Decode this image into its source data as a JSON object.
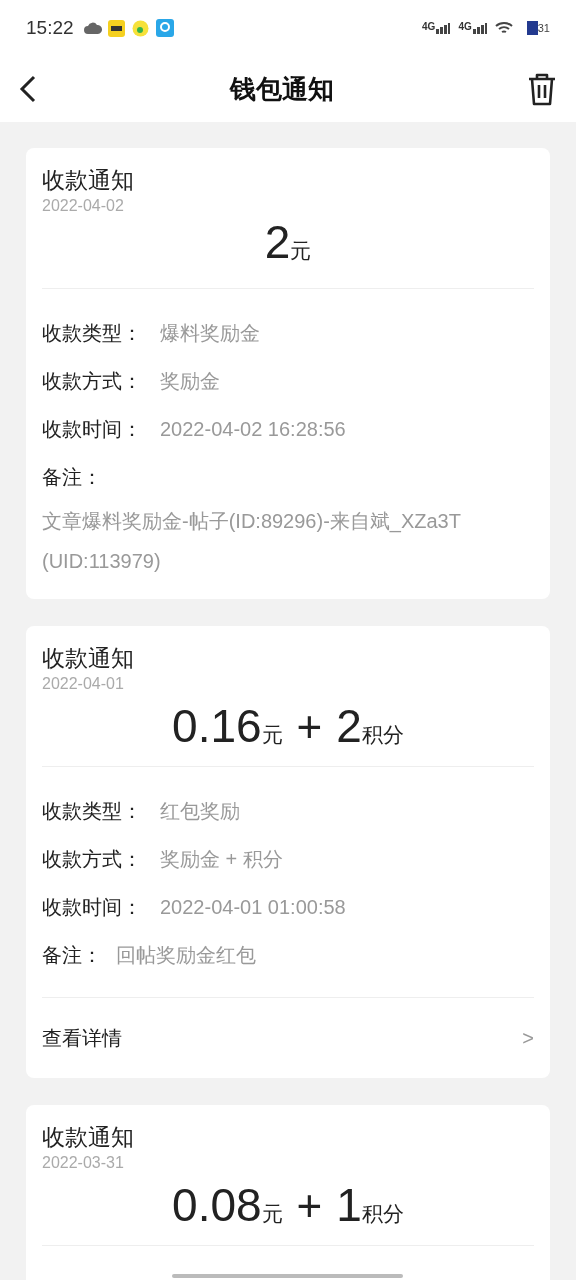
{
  "status_bar": {
    "time": "15:22",
    "network_1": "4G",
    "network_2": "4G",
    "battery": "31"
  },
  "header": {
    "title": "钱包通知"
  },
  "cards": [
    {
      "title": "收款通知",
      "date": "2022-04-02",
      "amount": [
        {
          "kind": "number",
          "text": "2"
        },
        {
          "kind": "unit",
          "text": "元"
        }
      ],
      "fields": [
        {
          "label": "收款类型：",
          "value": "爆料奖励金"
        },
        {
          "label": "收款方式：",
          "value": "奖励金"
        },
        {
          "label": "收款时间：",
          "value": "2022-04-02 16:28:56"
        }
      ],
      "note": {
        "kind": "block",
        "label": "备注：",
        "value": "文章爆料奖励金-帖子(ID:89296)-来自斌_XZa3T (UID:113979)"
      }
    },
    {
      "title": "收款通知",
      "date": "2022-04-01",
      "amount": [
        {
          "kind": "number",
          "text": "0.16"
        },
        {
          "kind": "unit",
          "text": "元"
        },
        {
          "kind": "plus",
          "text": "+"
        },
        {
          "kind": "number",
          "text": "2"
        },
        {
          "kind": "unit",
          "text": "积分"
        }
      ],
      "fields": [
        {
          "label": "收款类型：",
          "value": "红包奖励"
        },
        {
          "label": "收款方式：",
          "value": "奖励金 + 积分"
        },
        {
          "label": "收款时间：",
          "value": "2022-04-01 01:00:58"
        }
      ],
      "note": {
        "kind": "inline",
        "label": "备注：",
        "value": "回帖奖励金红包"
      },
      "details": {
        "label": "查看详情",
        "arrow": ">"
      }
    },
    {
      "title": "收款通知",
      "date": "2022-03-31",
      "amount": [
        {
          "kind": "number",
          "text": "0.08"
        },
        {
          "kind": "unit",
          "text": "元"
        },
        {
          "kind": "plus",
          "text": "+"
        },
        {
          "kind": "number",
          "text": "1"
        },
        {
          "kind": "unit",
          "text": "积分"
        }
      ]
    }
  ]
}
